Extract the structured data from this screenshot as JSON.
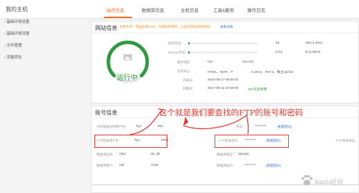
{
  "nav": {
    "brand": "我的主机",
    "tabs": [
      "站点信息",
      "数据库信息",
      "主机信息",
      "工具&服务",
      "操作日志"
    ],
    "active_index": 0
  },
  "sidebar": {
    "items": [
      "基础环境设置",
      "基础环境设置",
      "文件管理",
      "流量状态"
    ]
  },
  "site": {
    "title": "网站信息",
    "notice": "流量不足！网站启用CDN、流量即将用尽，让您的网站更快更稳！",
    "notice_link": "查看详情",
    "status": "运行中",
    "traffic": {
      "label": "网页空间：",
      "value": "26",
      "tail": "0M (1.36%)",
      "percent": 1.36
    },
    "mysql": {
      "label": "MySQL空间：",
      "value": "0.54",
      "tail": "B (1.55%)",
      "percent": 1.55
    },
    "domain": {
      "label": "临时域名：",
      "value": "hyu",
      "tail": "1w.com"
    },
    "support": {
      "label": "支持语言：",
      "value": "HTML、WAP、P",
      "tail": "5.4/5.5、Perl 5、独立cgi-bin"
    },
    "open_time": {
      "label": "开通日：",
      "value": "2016-05-17 08:50:04"
    },
    "expire": {
      "label": "到期日：",
      "value": "2017-06-11 23:59:59",
      "days": "203天后到期"
    }
  },
  "account": {
    "title": "账号信息",
    "host_admin": {
      "label": "主机管理控制用户名：",
      "value": "hyu",
      "tail": "001"
    },
    "host_pwd": {
      "label": "密码：",
      "value": "*********",
      "link": "[重置密码]"
    },
    "ftp_user": {
      "label": "FTP登录用户名：",
      "value": "hyu",
      "tail": "5001"
    },
    "ftp_pwd": {
      "label": "FTP登录密码：",
      "value": "*********",
      "link": "[重置密码]"
    },
    "ftp_addr": {
      "label": "FTP登录地址："
    },
    "db_name": {
      "label": "数据库名称：",
      "value": "hdm",
      "tail": "39_db"
    },
    "db_type": {
      "label": "数据库类型：",
      "value": "MySQL"
    },
    "db_user": {
      "label": "数据库用户：",
      "value": "hdr",
      "tail": "7138"
    },
    "db_pwd": {
      "label": "数据库密码：",
      "value": "*********",
      "link": "[重置密码]"
    }
  },
  "annotation": "这个就是我们要查找的FTP的账号和密码",
  "watermark": "Baidu经验",
  "colors": {
    "accent": "#f56b1a",
    "green": "#2e9b3f",
    "link": "#3a7bd5",
    "red": "#e8352b"
  }
}
